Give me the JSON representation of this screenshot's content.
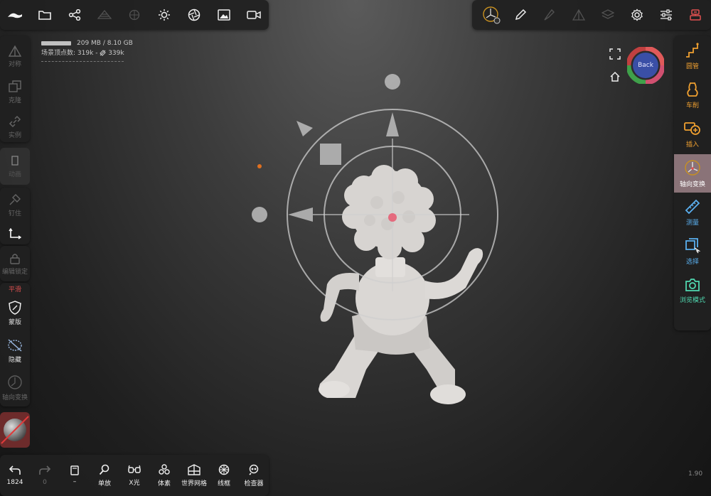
{
  "stats": {
    "memory": "209 MB / 8.10 GB",
    "vertex_label": "场景顶点数:",
    "vertex_value": "319k",
    "vertex_sep": "-",
    "vertex_linked": "339k"
  },
  "gizmo": {
    "back_label": "Back"
  },
  "right_bar": {
    "items": [
      {
        "label": "圆管",
        "icon": "tube-icon"
      },
      {
        "label": "车削",
        "icon": "lathe-icon"
      },
      {
        "label": "插入",
        "icon": "insert-icon"
      },
      {
        "label": "轴向变换",
        "icon": "axial-transform-icon"
      },
      {
        "label": "测量",
        "icon": "ruler-icon"
      },
      {
        "label": "选择",
        "icon": "select-icon"
      },
      {
        "label": "浏览模式",
        "icon": "camera-icon"
      }
    ]
  },
  "left_bar": {
    "items": [
      {
        "label": "对称"
      },
      {
        "label": "克隆"
      },
      {
        "label": "实例"
      },
      {
        "label": "动画"
      },
      {
        "label": "钉住"
      },
      {
        "label": "编辑锁定"
      },
      {
        "label": "平滑"
      },
      {
        "label": "蒙版"
      },
      {
        "label": "隐藏"
      },
      {
        "label": "轴向变换"
      }
    ]
  },
  "bottom_bar": {
    "undo_count": "1824",
    "redo_count": "0",
    "items": [
      {
        "label": "单放"
      },
      {
        "label": "X光"
      },
      {
        "label": "体素"
      },
      {
        "label": "世界网格"
      },
      {
        "label": "线框"
      },
      {
        "label": "检查器"
      }
    ]
  },
  "version": "1.90",
  "colors": {
    "accent": "#f0a030",
    "teal": "#50d8b0",
    "active_bg": "#8a7378",
    "panel": "#202020"
  }
}
